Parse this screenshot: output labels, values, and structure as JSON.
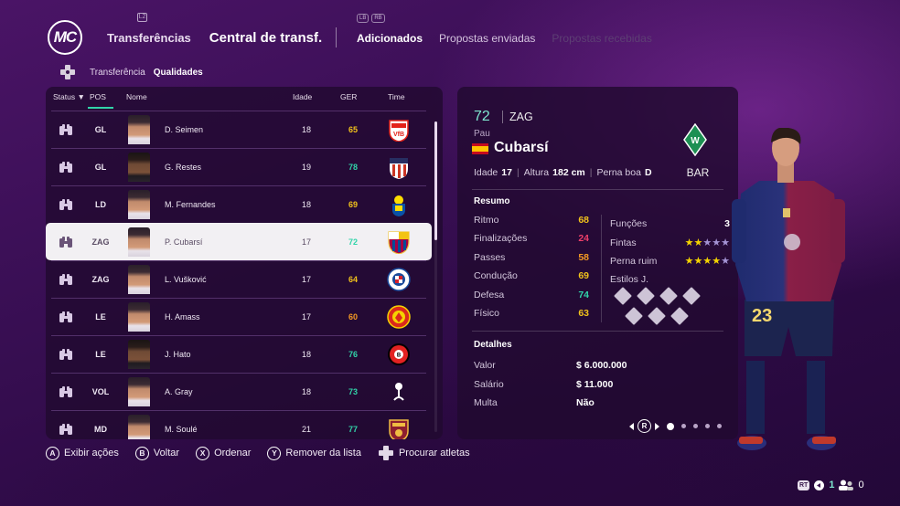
{
  "nav": {
    "logo": "MC",
    "lb_hint": "L2",
    "section1": "Transferências",
    "section2": "Central de transf.",
    "bumpers": [
      "LB",
      "RB"
    ],
    "tabs": [
      {
        "label": "Adicionados",
        "state": "active"
      },
      {
        "label": "Propostas enviadas",
        "state": "normal"
      },
      {
        "label": "Propostas recebidas",
        "state": "disabled"
      }
    ]
  },
  "filters": {
    "left": "Transferência",
    "right": "Qualidades"
  },
  "columns": {
    "status": "Status ▼",
    "pos": "POS",
    "name": "Nome",
    "age": "Idade",
    "ger": "GER",
    "team": "Time"
  },
  "colors": {
    "ger_yellow": "#f1c21b",
    "ger_green": "#31d4a9",
    "ger_orange": "#f59a23",
    "accent": "#31d4a9"
  },
  "players": [
    {
      "pos": "GL",
      "name": "D. Seimen",
      "age": "18",
      "ger": "65",
      "ger_color": "#f1c21b",
      "club_icon": "vfb-stuttgart-crest",
      "selected": false
    },
    {
      "pos": "GL",
      "name": "G. Restes",
      "age": "19",
      "ger": "78",
      "ger_color": "#31d4a9",
      "club_icon": "atletico-madrid-crest",
      "selected": false
    },
    {
      "pos": "LD",
      "name": "M. Fernandes",
      "age": "18",
      "ger": "69",
      "ger_color": "#f1c21b",
      "club_icon": "las-palmas-crest",
      "selected": false
    },
    {
      "pos": "ZAG",
      "name": "P. Cubarsí",
      "age": "17",
      "ger": "72",
      "ger_color": "#31d4a9",
      "club_icon": "fc-barcelona-crest",
      "selected": true
    },
    {
      "pos": "ZAG",
      "name": "L. Vušković",
      "age": "17",
      "ger": "64",
      "ger_color": "#f1c21b",
      "club_icon": "hajduk-split-crest",
      "selected": false
    },
    {
      "pos": "LE",
      "name": "H. Amass",
      "age": "17",
      "ger": "60",
      "ger_color": "#f59a23",
      "club_icon": "manchester-united-crest",
      "selected": false
    },
    {
      "pos": "LE",
      "name": "J. Hato",
      "age": "18",
      "ger": "76",
      "ger_color": "#31d4a9",
      "club_icon": "bayer-leverkusen-crest",
      "selected": false
    },
    {
      "pos": "VOL",
      "name": "A. Gray",
      "age": "18",
      "ger": "73",
      "ger_color": "#31d4a9",
      "club_icon": "tottenham-crest",
      "selected": false
    },
    {
      "pos": "MD",
      "name": "M. Soulé",
      "age": "21",
      "ger": "77",
      "ger_color": "#31d4a9",
      "club_icon": "as-roma-crest",
      "selected": false
    }
  ],
  "detail": {
    "ovr": "72",
    "position": "ZAG",
    "first_name": "Pau",
    "last_name": "Cubarsí",
    "nation_icon": "spain-flag",
    "bio": {
      "age_label": "Idade",
      "age": "17",
      "height_label": "Altura",
      "height": "182 cm",
      "foot_label": "Perna boa",
      "foot": "D"
    },
    "club_icon": "werder-bremen-crest",
    "club": "BAR",
    "summary_title": "Resumo",
    "stats": [
      {
        "label": "Ritmo",
        "value": "68",
        "color": "#f1c21b"
      },
      {
        "label": "Finalizações",
        "value": "24",
        "color": "#ef3f6a"
      },
      {
        "label": "Passes",
        "value": "58",
        "color": "#f59a23"
      },
      {
        "label": "Condução",
        "value": "69",
        "color": "#f1c21b"
      },
      {
        "label": "Defesa",
        "value": "74",
        "color": "#31d4a9"
      },
      {
        "label": "Físico",
        "value": "63",
        "color": "#f1c21b"
      }
    ],
    "attrs": {
      "roles_label": "Funções",
      "roles": "3",
      "skill_label": "Fintas",
      "skill_stars": 2,
      "skill_max": 5,
      "weak_label": "Perna ruim",
      "weak_stars": 4,
      "weak_max": 5,
      "styles_label": "Estilos J.",
      "styles_count": 7
    },
    "details_title": "Detalhes",
    "details": [
      {
        "label": "Valor",
        "value": "$ 6.000.000"
      },
      {
        "label": "Salário",
        "value": "$ 11.000"
      },
      {
        "label": "Multa",
        "value": "Não"
      }
    ],
    "pager": {
      "button": "R",
      "pages": 5,
      "current": 1
    }
  },
  "actions": [
    {
      "button": "A",
      "label": "Exibir ações"
    },
    {
      "button": "B",
      "label": "Voltar"
    },
    {
      "button": "X",
      "label": "Ordenar"
    },
    {
      "button": "Y",
      "label": "Remover da lista"
    },
    {
      "button": "dpad",
      "label": "Procurar atletas"
    }
  ],
  "corner": {
    "trigger": "RT",
    "count1": "1",
    "count2": "0"
  }
}
